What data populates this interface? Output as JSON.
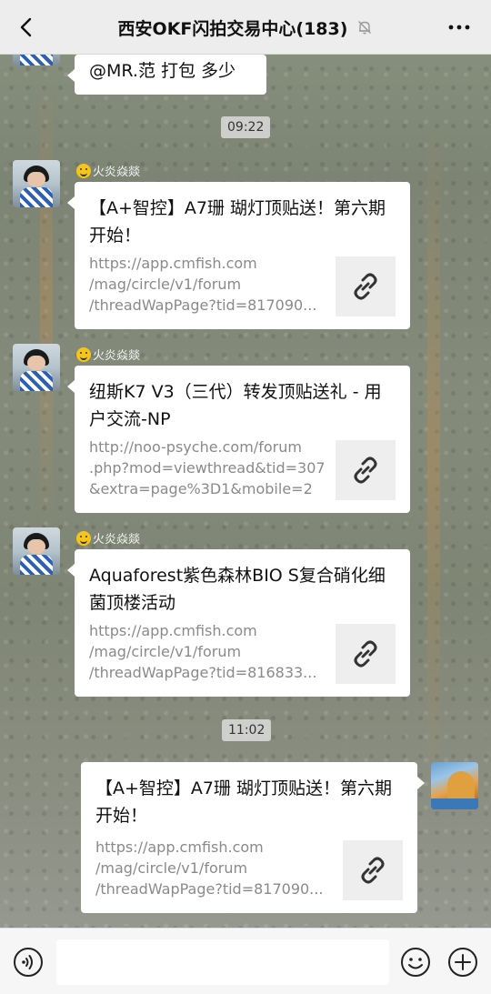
{
  "header": {
    "title": "西安OKF闪拍交易中心(183)",
    "back_icon": "back-arrow-icon",
    "mute_icon": "bell-off-icon",
    "more_icon": "more-dots-icon"
  },
  "messages": {
    "m0": {
      "text": "@MR.范  打包 多少"
    },
    "t1": "09:22",
    "m1": {
      "sender": "火炎焱燚",
      "title": "【A+智控】A7珊 瑚灯顶贴送！第六期开始！",
      "url_lines": [
        "https://app.cmfish.com",
        "/mag/circle/v1/forum",
        "/threadWapPage?tid=817090..."
      ]
    },
    "m2": {
      "sender": "火炎焱燚",
      "title": "纽斯K7 V3（三代）转发顶贴送礼 - 用户交流-NP",
      "url_lines": [
        "http://noo-psyche.com/forum",
        ".php?mod=viewthread&tid=307",
        "&extra=page%3D1&mobile=2"
      ]
    },
    "m3": {
      "sender": "火炎焱燚",
      "title": "Aquaforest紫色森林BIO S复合硝化细菌顶楼活动",
      "url_lines": [
        "https://app.cmfish.com",
        "/mag/circle/v1/forum",
        "/threadWapPage?tid=816833..."
      ]
    },
    "t2": "11:02",
    "m4": {
      "title": "【A+智控】A7珊 瑚灯顶贴送！第六期开始！",
      "url_lines": [
        "https://app.cmfish.com",
        "/mag/circle/v1/forum",
        "/threadWapPage?tid=817090..."
      ]
    }
  },
  "inputbar": {
    "voice_icon": "voice-icon",
    "emoji_icon": "emoji-icon",
    "plus_icon": "plus-icon",
    "input_value": ""
  }
}
